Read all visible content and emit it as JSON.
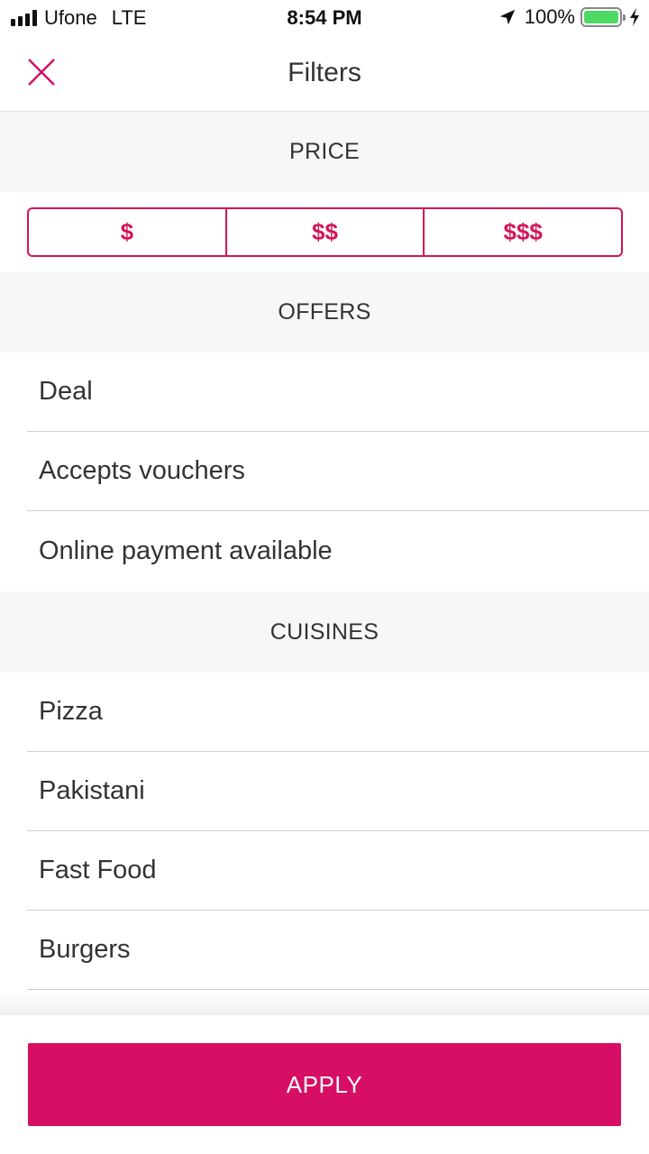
{
  "status_bar": {
    "carrier": "Ufone",
    "network": "LTE",
    "time": "8:54 PM",
    "battery": "100%",
    "battery_level": 1.0,
    "icons": [
      "signal-icon",
      "location-arrow-icon",
      "battery-icon",
      "charging-bolt-icon"
    ]
  },
  "header": {
    "title": "Filters",
    "close_icon": "close-icon"
  },
  "price": {
    "heading": "PRICE",
    "options": [
      "$",
      "$$",
      "$$$"
    ]
  },
  "offers": {
    "heading": "OFFERS",
    "items": [
      "Deal",
      "Accepts vouchers",
      "Online payment available"
    ]
  },
  "cuisines": {
    "heading": "CUISINES",
    "items": [
      "Pizza",
      "Pakistani",
      "Fast Food",
      "Burgers"
    ]
  },
  "footer": {
    "apply_label": "APPLY"
  },
  "colors": {
    "accent": "#d70f64",
    "section_bg": "#f7f7f7",
    "battery_green": "#4cd964"
  }
}
